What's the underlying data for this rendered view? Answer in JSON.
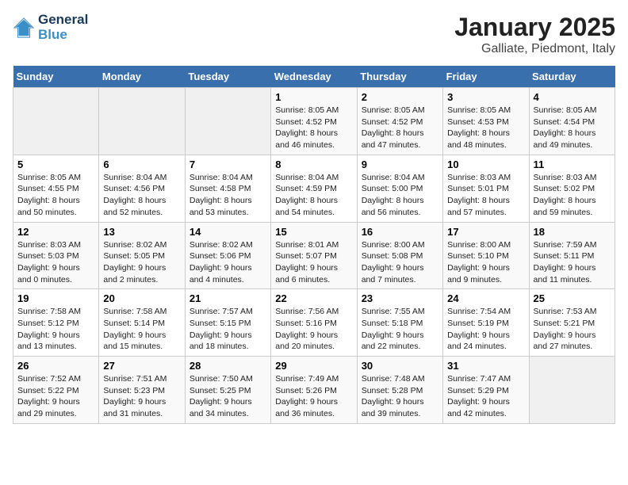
{
  "header": {
    "logo_line1": "General",
    "logo_line2": "Blue",
    "month": "January 2025",
    "location": "Galliate, Piedmont, Italy"
  },
  "weekdays": [
    "Sunday",
    "Monday",
    "Tuesday",
    "Wednesday",
    "Thursday",
    "Friday",
    "Saturday"
  ],
  "weeks": [
    [
      {
        "day": "",
        "info": ""
      },
      {
        "day": "",
        "info": ""
      },
      {
        "day": "",
        "info": ""
      },
      {
        "day": "1",
        "info": "Sunrise: 8:05 AM\nSunset: 4:52 PM\nDaylight: 8 hours\nand 46 minutes."
      },
      {
        "day": "2",
        "info": "Sunrise: 8:05 AM\nSunset: 4:52 PM\nDaylight: 8 hours\nand 47 minutes."
      },
      {
        "day": "3",
        "info": "Sunrise: 8:05 AM\nSunset: 4:53 PM\nDaylight: 8 hours\nand 48 minutes."
      },
      {
        "day": "4",
        "info": "Sunrise: 8:05 AM\nSunset: 4:54 PM\nDaylight: 8 hours\nand 49 minutes."
      }
    ],
    [
      {
        "day": "5",
        "info": "Sunrise: 8:05 AM\nSunset: 4:55 PM\nDaylight: 8 hours\nand 50 minutes."
      },
      {
        "day": "6",
        "info": "Sunrise: 8:04 AM\nSunset: 4:56 PM\nDaylight: 8 hours\nand 52 minutes."
      },
      {
        "day": "7",
        "info": "Sunrise: 8:04 AM\nSunset: 4:58 PM\nDaylight: 8 hours\nand 53 minutes."
      },
      {
        "day": "8",
        "info": "Sunrise: 8:04 AM\nSunset: 4:59 PM\nDaylight: 8 hours\nand 54 minutes."
      },
      {
        "day": "9",
        "info": "Sunrise: 8:04 AM\nSunset: 5:00 PM\nDaylight: 8 hours\nand 56 minutes."
      },
      {
        "day": "10",
        "info": "Sunrise: 8:03 AM\nSunset: 5:01 PM\nDaylight: 8 hours\nand 57 minutes."
      },
      {
        "day": "11",
        "info": "Sunrise: 8:03 AM\nSunset: 5:02 PM\nDaylight: 8 hours\nand 59 minutes."
      }
    ],
    [
      {
        "day": "12",
        "info": "Sunrise: 8:03 AM\nSunset: 5:03 PM\nDaylight: 9 hours\nand 0 minutes."
      },
      {
        "day": "13",
        "info": "Sunrise: 8:02 AM\nSunset: 5:05 PM\nDaylight: 9 hours\nand 2 minutes."
      },
      {
        "day": "14",
        "info": "Sunrise: 8:02 AM\nSunset: 5:06 PM\nDaylight: 9 hours\nand 4 minutes."
      },
      {
        "day": "15",
        "info": "Sunrise: 8:01 AM\nSunset: 5:07 PM\nDaylight: 9 hours\nand 6 minutes."
      },
      {
        "day": "16",
        "info": "Sunrise: 8:00 AM\nSunset: 5:08 PM\nDaylight: 9 hours\nand 7 minutes."
      },
      {
        "day": "17",
        "info": "Sunrise: 8:00 AM\nSunset: 5:10 PM\nDaylight: 9 hours\nand 9 minutes."
      },
      {
        "day": "18",
        "info": "Sunrise: 7:59 AM\nSunset: 5:11 PM\nDaylight: 9 hours\nand 11 minutes."
      }
    ],
    [
      {
        "day": "19",
        "info": "Sunrise: 7:58 AM\nSunset: 5:12 PM\nDaylight: 9 hours\nand 13 minutes."
      },
      {
        "day": "20",
        "info": "Sunrise: 7:58 AM\nSunset: 5:14 PM\nDaylight: 9 hours\nand 15 minutes."
      },
      {
        "day": "21",
        "info": "Sunrise: 7:57 AM\nSunset: 5:15 PM\nDaylight: 9 hours\nand 18 minutes."
      },
      {
        "day": "22",
        "info": "Sunrise: 7:56 AM\nSunset: 5:16 PM\nDaylight: 9 hours\nand 20 minutes."
      },
      {
        "day": "23",
        "info": "Sunrise: 7:55 AM\nSunset: 5:18 PM\nDaylight: 9 hours\nand 22 minutes."
      },
      {
        "day": "24",
        "info": "Sunrise: 7:54 AM\nSunset: 5:19 PM\nDaylight: 9 hours\nand 24 minutes."
      },
      {
        "day": "25",
        "info": "Sunrise: 7:53 AM\nSunset: 5:21 PM\nDaylight: 9 hours\nand 27 minutes."
      }
    ],
    [
      {
        "day": "26",
        "info": "Sunrise: 7:52 AM\nSunset: 5:22 PM\nDaylight: 9 hours\nand 29 minutes."
      },
      {
        "day": "27",
        "info": "Sunrise: 7:51 AM\nSunset: 5:23 PM\nDaylight: 9 hours\nand 31 minutes."
      },
      {
        "day": "28",
        "info": "Sunrise: 7:50 AM\nSunset: 5:25 PM\nDaylight: 9 hours\nand 34 minutes."
      },
      {
        "day": "29",
        "info": "Sunrise: 7:49 AM\nSunset: 5:26 PM\nDaylight: 9 hours\nand 36 minutes."
      },
      {
        "day": "30",
        "info": "Sunrise: 7:48 AM\nSunset: 5:28 PM\nDaylight: 9 hours\nand 39 minutes."
      },
      {
        "day": "31",
        "info": "Sunrise: 7:47 AM\nSunset: 5:29 PM\nDaylight: 9 hours\nand 42 minutes."
      },
      {
        "day": "",
        "info": ""
      }
    ]
  ]
}
